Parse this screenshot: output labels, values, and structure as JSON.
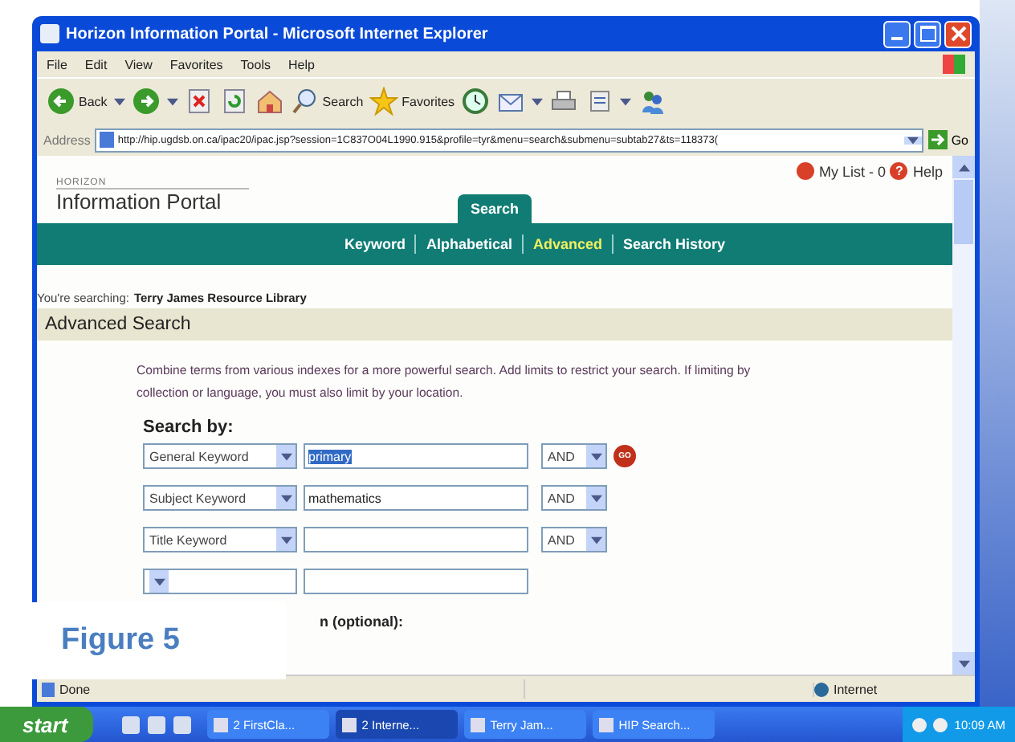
{
  "window": {
    "title": "Horizon Information Portal - Microsoft Internet Explorer"
  },
  "menu": [
    "File",
    "Edit",
    "View",
    "Favorites",
    "Tools",
    "Help"
  ],
  "toolbar": [
    {
      "kind": "back",
      "label": "Back"
    },
    {
      "kind": "forward"
    },
    {
      "kind": "stop"
    },
    {
      "kind": "refresh"
    },
    {
      "kind": "home"
    },
    {
      "kind": "search",
      "label": "Search"
    },
    {
      "kind": "favorites",
      "label": "Favorites"
    },
    {
      "kind": "history"
    },
    {
      "kind": "mail"
    },
    {
      "kind": "print"
    },
    {
      "kind": "edit"
    },
    {
      "kind": "messenger"
    }
  ],
  "address": {
    "label": "Address",
    "url": "http://hip.ugdsb.on.ca/ipac20/ipac.jsp?session=1C837O04L1990.915&profile=tyr&menu=search&submenu=subtab27&ts=118373(",
    "go": "Go"
  },
  "page": {
    "logo_small": "HORIZON",
    "logo": "Information Portal",
    "my_list": "My List - 0",
    "help_icon": "?",
    "help": "Help",
    "tabs": [
      {
        "label": "Search",
        "selected": true
      }
    ],
    "subnav": [
      {
        "label": "Keyword",
        "selected": false
      },
      {
        "label": "Alphabetical",
        "selected": false
      },
      {
        "label": "Advanced",
        "selected": true
      },
      {
        "label": "Search History",
        "selected": false
      }
    ],
    "searching_label": "You're searching:",
    "library": "Terry James Resource Library",
    "heading": "Advanced Search",
    "intro": "Combine terms from various indexes for a more powerful search. Add limits to restrict your search. If limiting by collection or language, you must also limit by your location.",
    "search_by": "Search by:",
    "rows": [
      {
        "index": "General Keyword",
        "term": "primary",
        "term_selected": true,
        "operator": "AND",
        "go": "GO"
      },
      {
        "index": "Subject Keyword",
        "term": "mathematics",
        "term_selected": false,
        "operator": "AND"
      },
      {
        "index": "Title Keyword",
        "term_selected": false,
        "operator": "AND"
      },
      {
        "term_selected": false
      }
    ],
    "limit_partial": "n (optional):"
  },
  "status_bar": {
    "text": "Done",
    "zone": "Internet"
  },
  "taskbar": {
    "start": "start",
    "tasks": [
      {
        "label": "2 FirstCla...",
        "selected": false
      },
      {
        "label": "2 Interne...",
        "selected": true
      },
      {
        "label": "Terry Jam...",
        "selected": false
      },
      {
        "label": "HIP Search...",
        "selected": false
      }
    ],
    "clock": "10:09 AM"
  },
  "figure_label": "Figure 5"
}
